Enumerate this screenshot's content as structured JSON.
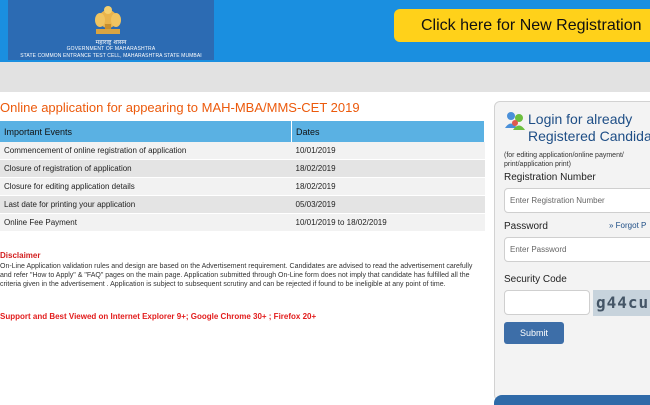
{
  "header": {
    "logo": {
      "marathi_text": "महाराष्ट्र शासन",
      "line1": "GOVERNMENT OF MAHARASHTRA",
      "line2": "STATE COMMON ENTRANCE TEST CELL, MAHARASHTRA STATE MUMBAI"
    },
    "register_button": "Click here for New Registration"
  },
  "main": {
    "title": "Online application for appearing to MAH-MBA/MMS-CET 2019",
    "events_table": {
      "headers": [
        "Important Events",
        "Dates"
      ],
      "rows": [
        [
          "Commencement of online registration of application",
          "10/01/2019"
        ],
        [
          "Closure of registration of application",
          "18/02/2019"
        ],
        [
          "Closure for editing application details",
          "18/02/2019"
        ],
        [
          "Last date for printing your application",
          "05/03/2019"
        ],
        [
          "Online Fee Payment",
          "10/01/2019 to 18/02/2019"
        ]
      ]
    },
    "disclaimer_title": "Disclaimer",
    "disclaimer_text": "On-Line Application validation rules and design are based on the Advertisement requirement. Candidates are advised to read the advertisement carefully and refer \"How to Apply\" & \"FAQ\" pages on the main page. Application submitted through On-Line form does not imply that candidate has fulfilled all the criteria given in the advertisement . Application is subject to subsequent scrutiny and can be rejected if found to be ineligible at any point of time.",
    "support_text": "Support and Best Viewed on Internet Explorer 9+; Google Chrome 30+ ; Firefox 20+"
  },
  "login": {
    "title_line1": "Login for already",
    "title_line2": "Registered Candida",
    "note": "(for editing application/online payment/ print/application print)",
    "registration_label": "Registration Number",
    "registration_placeholder": "Enter Registration Number",
    "password_label": "Password",
    "forgot_label": "» Forgot P",
    "password_placeholder": "Enter Password",
    "security_label": "Security Code",
    "captcha_text": "g44cu",
    "submit_label": "Submit"
  },
  "colors": {
    "header_bg": "#1a8fe0",
    "register_button_bg": "#ffd11a",
    "title_orange": "#ec5a0c",
    "table_header": "#5ab1e3",
    "disclaimer_red": "#d21e1e",
    "submit_blue": "#3d6ea8"
  }
}
